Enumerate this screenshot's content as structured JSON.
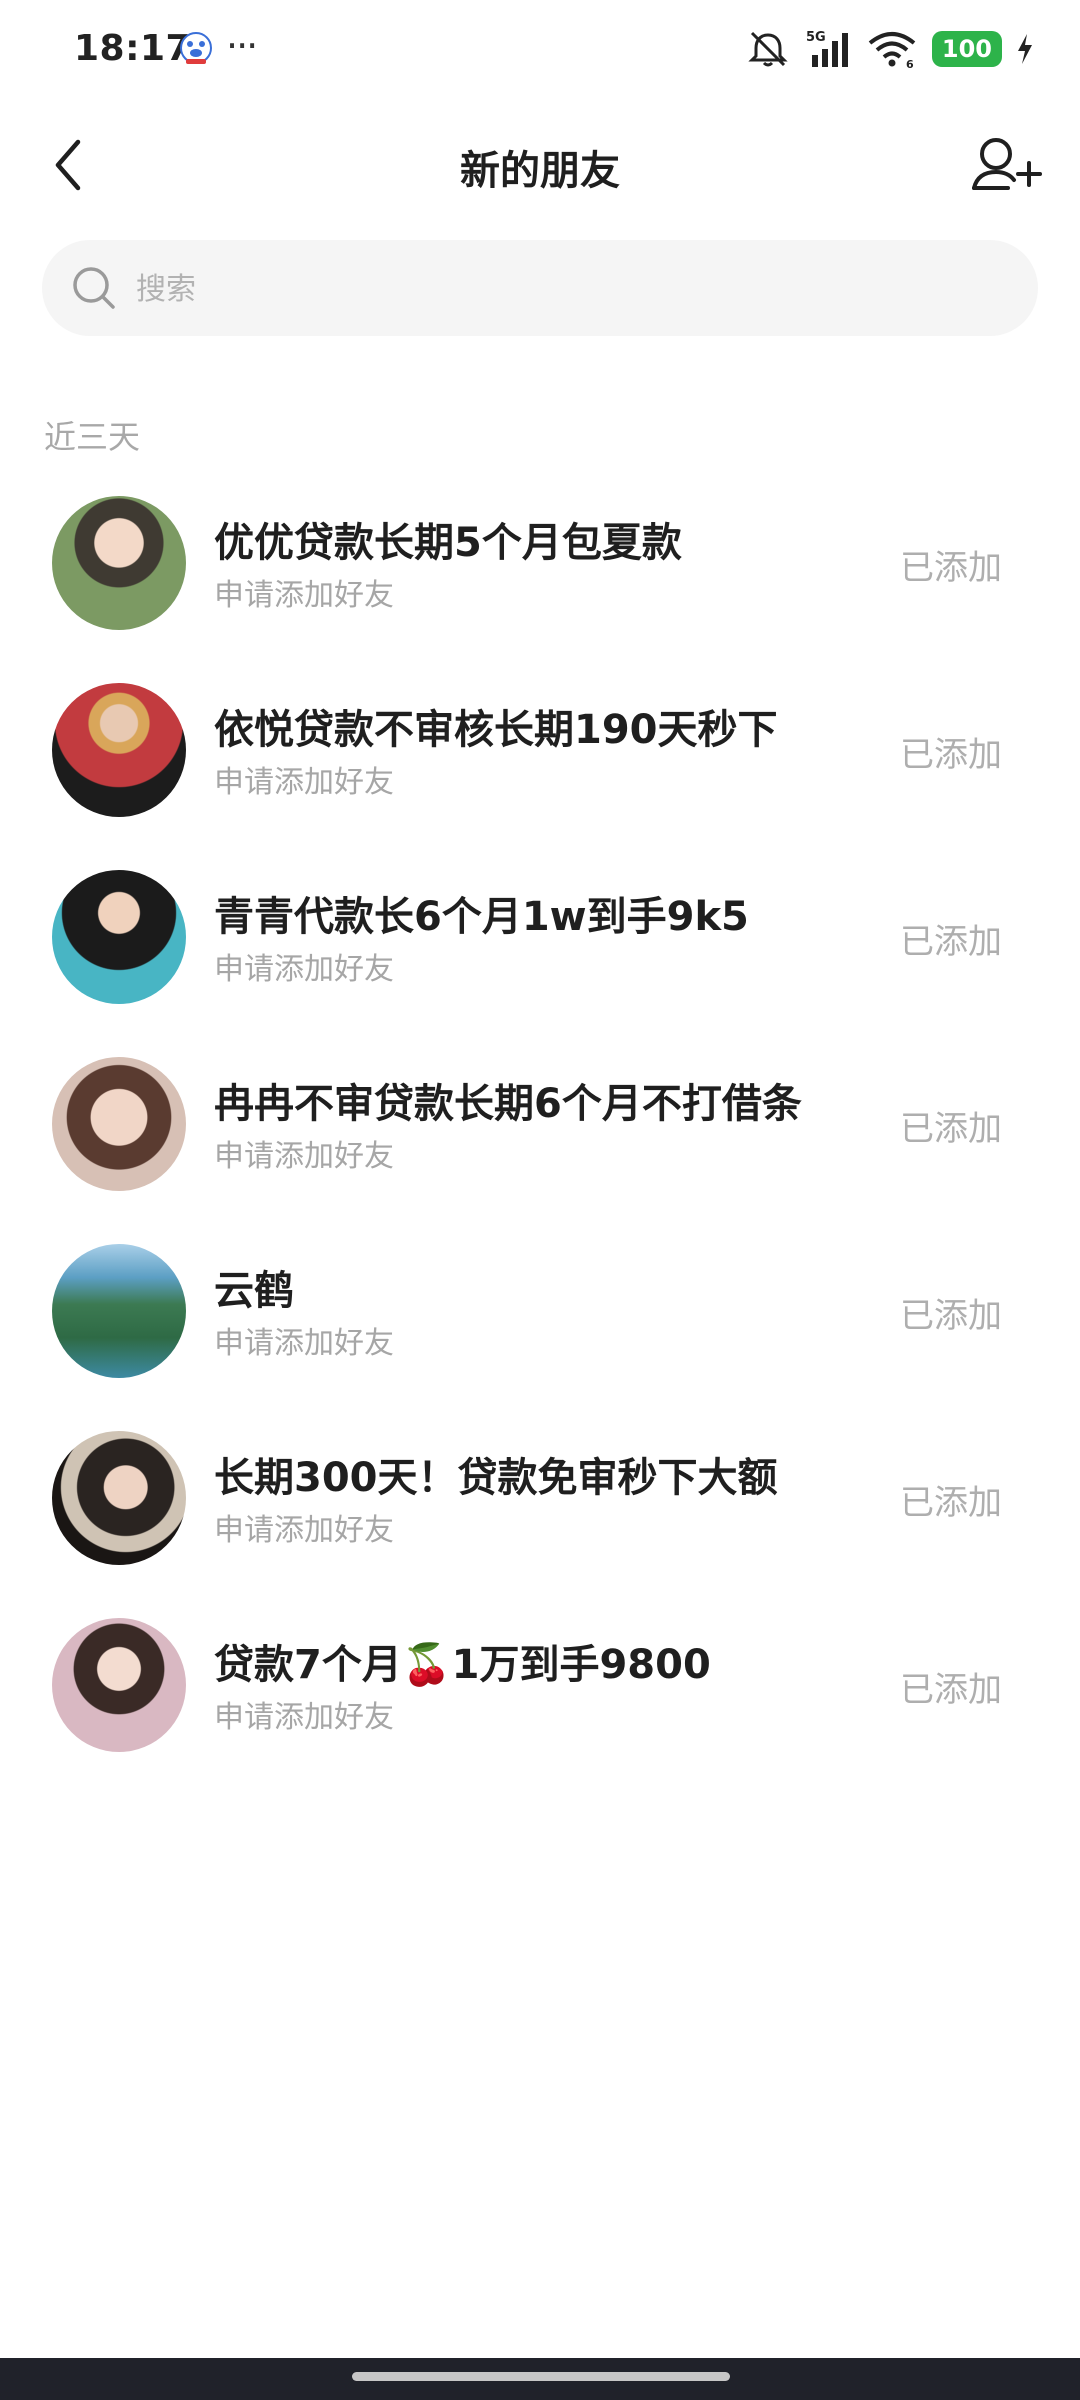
{
  "status_bar": {
    "time": "18:17",
    "more": "···",
    "network_label": "5G",
    "wifi_label": "6",
    "battery": "100",
    "icons": [
      "app-notification-icon",
      "mute-icon",
      "signal-icon",
      "wifi-icon",
      "battery-icon",
      "charging-icon"
    ]
  },
  "header": {
    "title": "新的朋友",
    "back_icon": "chevron-left-icon",
    "add_icon": "add-friend-icon"
  },
  "search": {
    "placeholder": "搜索"
  },
  "section": {
    "label": "近三天"
  },
  "friends": [
    {
      "name": "优优贷款长期5个月包夏款",
      "subtitle": "申请添加好友",
      "status": "已添加",
      "avatar_color": "#6b8b5a"
    },
    {
      "name": "依悦贷款不审核长期190天秒下",
      "subtitle": "申请添加好友",
      "status": "已添加",
      "avatar_color": "#b5343a"
    },
    {
      "name": "青青代款长6个月1w到手9k5",
      "subtitle": "申请添加好友",
      "status": "已添加",
      "avatar_color": "#3ea6b8"
    },
    {
      "name": "冉冉不审贷款长期6个月不打借条",
      "subtitle": "申请添加好友",
      "status": "已添加",
      "avatar_color": "#c98f84"
    },
    {
      "name": "云鹤",
      "subtitle": "申请添加好友",
      "status": "已添加",
      "avatar_color": "#3f7f5a"
    },
    {
      "name": "长期300天！贷款免审秒下大额",
      "subtitle": "申请添加好友",
      "status": "已添加",
      "avatar_color": "#2c2622"
    },
    {
      "name": "贷款7个月🍒1万到手9800",
      "subtitle": "申请添加好友",
      "status": "已添加",
      "avatar_color": "#d8b8bf"
    }
  ]
}
